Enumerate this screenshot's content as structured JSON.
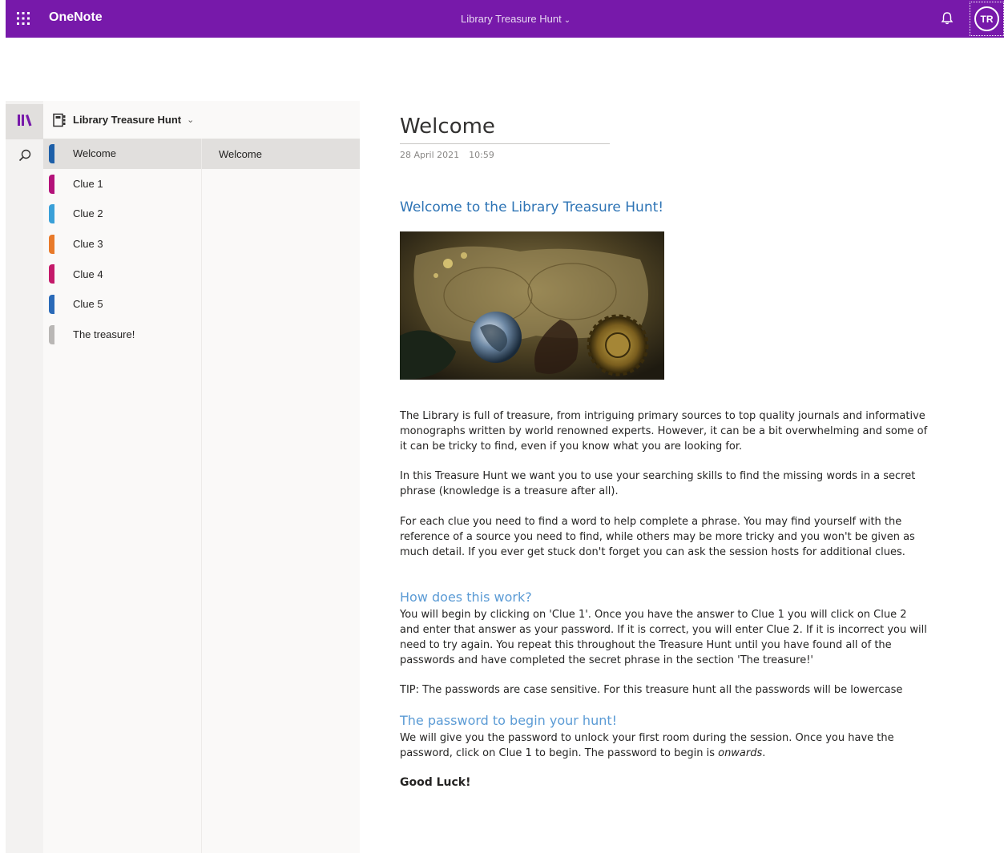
{
  "topbar": {
    "app_name": "OneNote",
    "notebook_title": "Library Treasure Hunt",
    "chevron": "⌄",
    "avatar_initials": "TR",
    "bar_color": "#7719aa"
  },
  "rail": {
    "library_icon": "library-icon",
    "search_icon": "search-icon"
  },
  "nav": {
    "notebook_name": "Library Treasure Hunt",
    "chevron": "⌄",
    "sections": [
      {
        "label": "Welcome",
        "color": "#1d5fa8"
      },
      {
        "label": "Clue 1",
        "color": "#b4127a"
      },
      {
        "label": "Clue 2",
        "color": "#3aa0d8"
      },
      {
        "label": "Clue 3",
        "color": "#e87a2a"
      },
      {
        "label": "Clue 4",
        "color": "#c41a6a"
      },
      {
        "label": "Clue 5",
        "color": "#2a6ab8"
      },
      {
        "label": "The treasure!",
        "color": "#b9b7b5"
      }
    ],
    "pages": [
      {
        "label": "Welcome"
      }
    ]
  },
  "page": {
    "title": "Welcome",
    "date": "28 April 2021",
    "time": "10:59",
    "heading": "Welcome to the Library Treasure Hunt!",
    "para1": "The Library is full of treasure, from intriguing primary sources to top quality journals and informative monographs written by world renowned experts. However, it can be a bit overwhelming and some of it can be  tricky to find, even if you know what you are looking for.",
    "para2": "In this Treasure Hunt we want you to use your searching skills to find the missing words in a secret phrase (knowledge is a treasure after all).",
    "para3": "For each clue you need to find a word to help complete a phrase. You may find yourself with the reference of a source you need to find, while others may be more tricky and you won't be given as much detail. If you ever get stuck don't forget you can ask the session hosts for additional clues.",
    "subheading1": "How does this work?",
    "para4": "You will begin by clicking on 'Clue 1'. Once you have the answer to Clue 1 you will click on Clue 2 and enter that answer as your password. If it is correct, you will enter Clue 2. If it is incorrect you will need to try again. You repeat this throughout the Treasure Hunt until you have found all of the passwords and have completed the secret phrase in the section 'The treasure!'",
    "para5": "TIP: The passwords are case sensitive. For this treasure hunt all the passwords will be lowercase",
    "subheading2": "The password to begin your hunt!",
    "para6_prefix": "We will give you the password to unlock your first room during the session. Once you have the password, click on Clue 1 to begin. The password to begin is ",
    "para6_emph": "onwards",
    "para6_suffix": ".",
    "closing": "Good Luck!"
  }
}
